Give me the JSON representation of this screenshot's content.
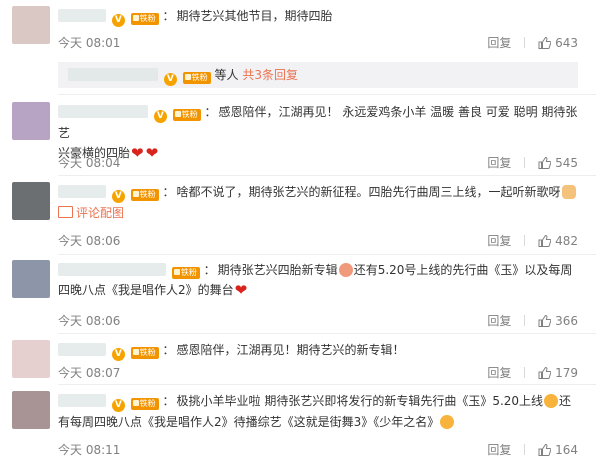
{
  "comments": [
    {
      "time": "今天 08:01",
      "text": "期待艺兴其他节目，期待四胎",
      "reply_label": "回复",
      "likes": "643",
      "avatar_color": "#d9c8c4",
      "sub_reply": {
        "text_a": "等人",
        "link": "共3条回复"
      }
    },
    {
      "time": "今天 08:04",
      "text1": "感恩陪伴，江湖再见！",
      "text2": "永远爱鸡条小羊 温暖 善良 可爱 聪明 期待张艺",
      "text3": "兴豪横的四胎",
      "reply_label": "回复",
      "likes": "545",
      "avatar_color": "#b7a3c3"
    },
    {
      "time": "今天 08:06",
      "text": "啥都不说了，期待张艺兴的新征程。四胎先行曲周三上线，一起听新歌呀",
      "pic_link": "评论配图",
      "reply_label": "回复",
      "likes": "482",
      "avatar_color": "#6b6f72"
    },
    {
      "time": "今天 08:06",
      "text1": "期待张艺兴四胎新专辑",
      "text2": "还有5.20号上线的先行曲《玉》以及每周",
      "text3": "四晚八点《我是唱作人2》的舞台",
      "reply_label": "回复",
      "likes": "366",
      "avatar_color": "#8d95a8"
    },
    {
      "time": "今天 08:07",
      "text": "感恩陪伴，江湖再见！期待艺兴的新专辑！",
      "reply_label": "回复",
      "likes": "179",
      "avatar_color": "#e6cfcf"
    },
    {
      "time": "今天 08:11",
      "text1": "极挑小羊毕业啦  期待张艺兴即将发行的新专辑先行曲《玉》5.20上线",
      "text1b": "还",
      "text2": "有每周四晚八点《我是唱作人2》待播综艺《这就是街舞3》《少年之名》",
      "reply_label": "回复",
      "likes": "164",
      "avatar_color": "#a89494"
    }
  ],
  "badges": {
    "v": "V",
    "fan": "铁粉"
  },
  "colors": {
    "link": "#eb7350",
    "meta": "#808080",
    "badge": "#f29400"
  },
  "icons": [
    "like-icon",
    "picture-icon",
    "heart-emoji",
    "face-emoji"
  ]
}
